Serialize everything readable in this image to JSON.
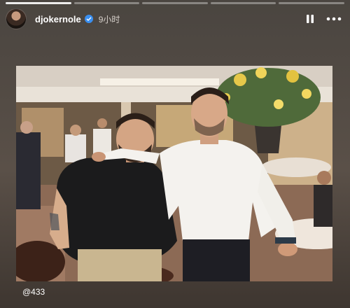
{
  "story": {
    "progress_segments": 5,
    "progress_done": 1,
    "username": "djokernole",
    "verified": true,
    "timestamp": "9小时",
    "mention": "@433"
  },
  "colors": {
    "verified_badge": "#3a8ff0",
    "background": "#4a4540"
  },
  "icons": {
    "pause": "pause-icon",
    "more": "more-icon"
  }
}
